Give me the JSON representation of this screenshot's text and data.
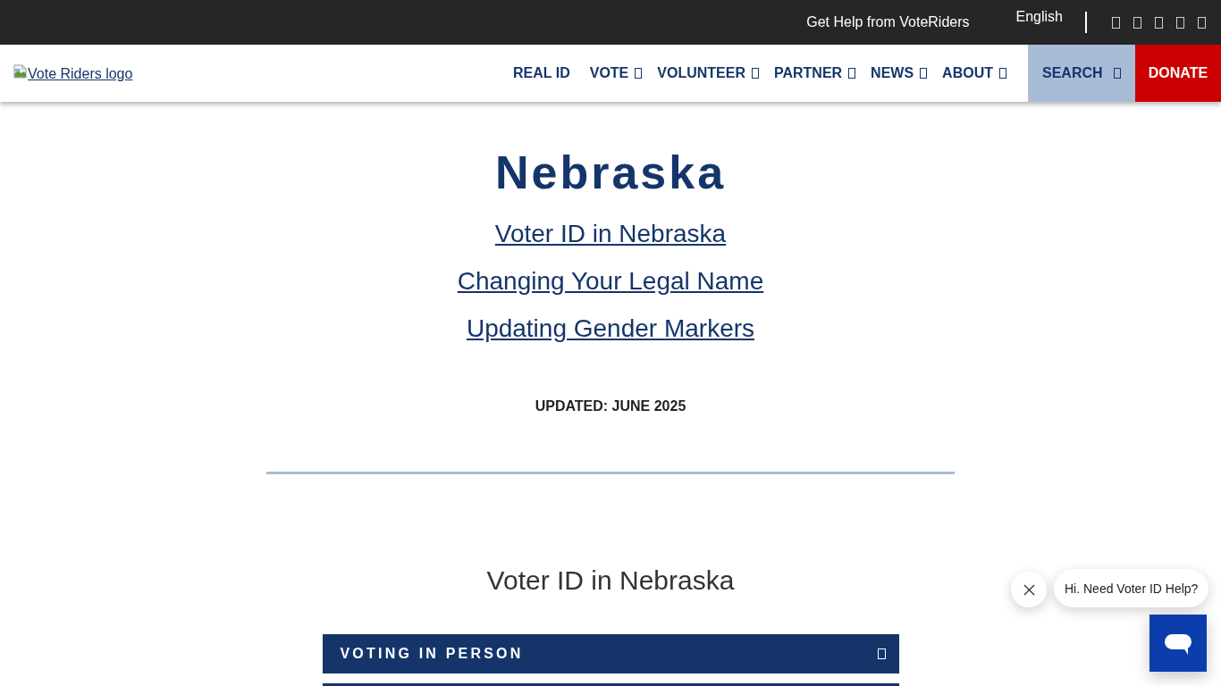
{
  "top_bar": {
    "help_link": "Get Help from VoteRiders",
    "language": "English"
  },
  "header": {
    "logo_alt": "Vote Riders logo",
    "nav": [
      {
        "label": "REAL ID",
        "dropdown": false
      },
      {
        "label": "VOTE",
        "dropdown": true
      },
      {
        "label": "VOLUNTEER",
        "dropdown": true
      },
      {
        "label": "PARTNER",
        "dropdown": true
      },
      {
        "label": "NEWS",
        "dropdown": true
      },
      {
        "label": "ABOUT",
        "dropdown": true
      }
    ],
    "search": "SEARCH",
    "donate": "DONATE"
  },
  "page": {
    "title": "Nebraska",
    "links": [
      "Voter ID in Nebraska",
      "Changing Your Legal Name",
      "Updating Gender Markers"
    ],
    "updated": "UPDATED: JUNE 2025",
    "section_title": "Voter ID in Nebraska",
    "accordion": [
      {
        "title": "VOTING IN PERSON"
      }
    ]
  },
  "chat": {
    "greeting": "Hi. Need Voter ID Help?"
  }
}
